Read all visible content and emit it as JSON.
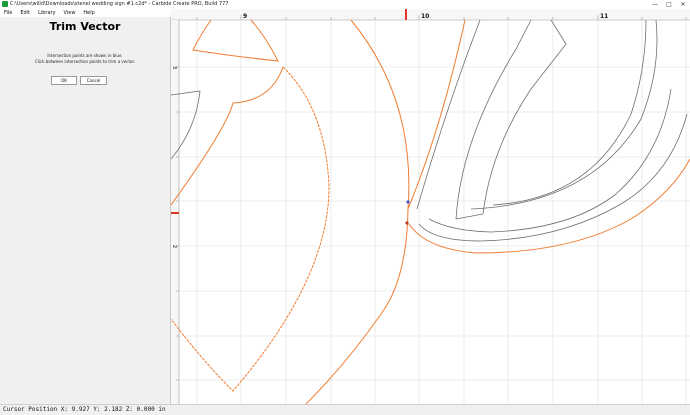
{
  "window": {
    "title": "C:\\Users\\willd\\Downloads\\stenel wedding sign #1.c2d* - Carbide Create PRO, Build 777",
    "controls": [
      "—",
      "□",
      "✕"
    ]
  },
  "menu": [
    "File",
    "Edit",
    "Library",
    "View",
    "Help"
  ],
  "panel": {
    "title": "Trim Vector",
    "line1": "Intersection points are shown in blue.",
    "line2": "Click between intersection points to trim a vector.",
    "ok_label": "OK",
    "cancel_label": "Cancel"
  },
  "ruler": {
    "x_labels": [
      "9",
      "10",
      "11"
    ],
    "y_labels": [
      "3",
      "2"
    ]
  },
  "status": {
    "text": "Cursor Position X: 9.927 Y: 2.182 Z: 0.000 in"
  },
  "colors": {
    "vector_orange": "#f07d31",
    "vector_gray": "#6e6e6e",
    "grid": "#dedede",
    "intersection_blue": "#4060d0",
    "ruler_marker": "#e0352b"
  }
}
